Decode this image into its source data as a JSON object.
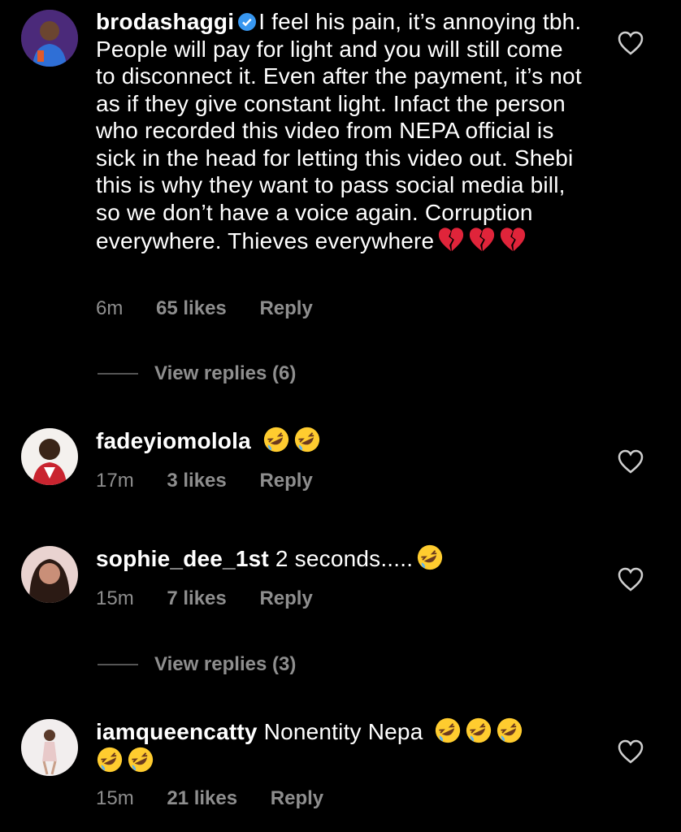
{
  "comments": [
    {
      "username": "brodashaggi",
      "verified": true,
      "text": "I feel his pain, it’s annoying tbh. People will pay for light and you will still come to disconnect it. Even after the payment, it’s not as if they give constant light. Infact the person who recorded this video from NEPA official is sick in the head for letting this video out. Shebi this is why they want to pass social media bill, so we don’t have a voice again. Corruption everywhere. Thieves everywhere",
      "time": "6m",
      "likes": "65 likes",
      "reply_label": "Reply",
      "view_replies": "View replies (6)"
    },
    {
      "username": "fadeyiomolola",
      "text": "",
      "time": "17m",
      "likes": "3 likes",
      "reply_label": "Reply"
    },
    {
      "username": "sophie_dee_1st",
      "text": "2 seconds.....",
      "time": "15m",
      "likes": "7 likes",
      "reply_label": "Reply",
      "view_replies": "View replies (3)"
    },
    {
      "username": "iamqueencatty",
      "text": "Nonentity Nepa",
      "time": "15m",
      "likes": "21 likes",
      "reply_label": "Reply"
    }
  ],
  "colors": {
    "background": "#000000",
    "text": "#ffffff",
    "secondary": "#8e8e8e",
    "verified": "#3897f0"
  },
  "icons": [
    "verified-badge-icon",
    "heart-outline-icon",
    "broken-heart-emoji",
    "rofl-emoji"
  ]
}
